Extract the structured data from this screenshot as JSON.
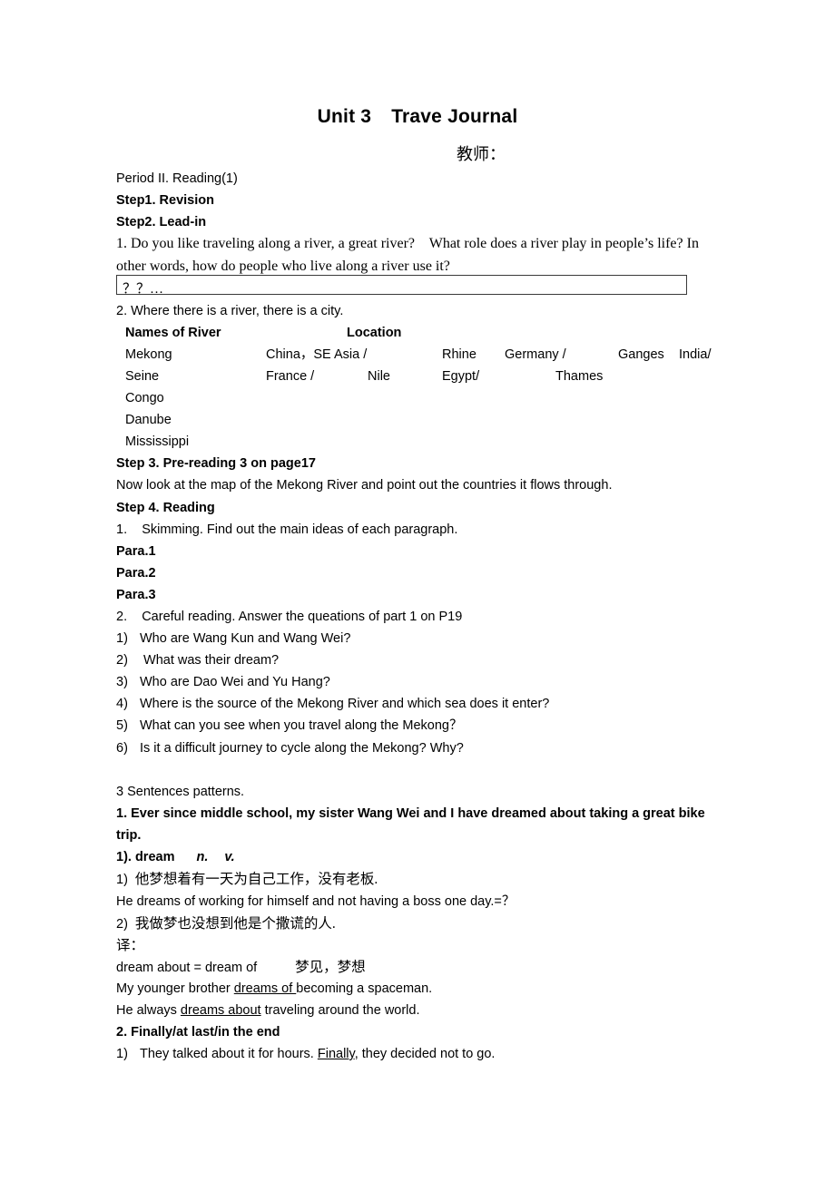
{
  "document": {
    "title_main": "Unit 3",
    "title_sub": "Trave Journal",
    "teacher_label": "教师：",
    "period": "Period II. Reading(1)",
    "step1": "Step1. Revision",
    "step2": "Step2. Lead-in",
    "lead_in_line1": "1. Do you like traveling along a river, a great river?    What role does a river play in people’s life? In",
    "lead_in_line2": "other words, how do people who live along a river use it?",
    "answer_box_text": "？？…",
    "where_line": "2. Where there is a river, there is a city.",
    "step3": "Step 3. Pre-reading 3 on page17",
    "step3_text": "Now look at the map of the Mekong River and point out the countries it flows through.",
    "step4": "Step 4. Reading",
    "skimming": "1.    Skimming. Find out the main ideas of each paragraph.",
    "para1": "Para.1",
    "para2": "Para.2",
    "para3": "Para.3",
    "careful_reading": "2.    Careful reading. Answer the queations of part 1 on P19",
    "questions": [
      {
        "num": "1)",
        "text": "Who are Wang Kun and Wang Wei?"
      },
      {
        "num": "2)",
        "text": " What was their dream?"
      },
      {
        "num": "3)",
        "text": "Who are Dao Wei and Yu Hang?"
      },
      {
        "num": "4)",
        "text": "Where is the source of the Mekong River and which sea does it enter?"
      },
      {
        "num": "5)",
        "text": "What can you see when you travel along the Mekong？"
      },
      {
        "num": "6)",
        "text": "Is it a difficult journey to cycle along the Mekong? Why?"
      }
    ],
    "sentences_heading": "3 Sentences patterns.",
    "pattern1_line1": "1. Ever since middle school, my sister Wang Wei and I have dreamed about taking a great bike",
    "pattern1_line2": "trip.",
    "dream_entry": "1). dream",
    "dream_pos_n": "n.",
    "dream_pos_v": "v.",
    "cn_example1_num": "1)",
    "cn_example1": "他梦想着有一天为自己工作，没有老板.",
    "en_example1": "He dreams of working for himself and not having a boss one day.=？",
    "cn_example2_num": "2)",
    "cn_example2": "我做梦也没想到他是个撒谎的人.",
    "translate_label": "译：",
    "dream_about_eq": "dream about = dream of",
    "dream_about_cn": "梦见，梦想",
    "spaceman_pre": "My younger brother ",
    "spaceman_underline": "dreams of ",
    "spaceman_post": "becoming a spaceman.",
    "world_pre": "He always ",
    "world_underline": "dreams about",
    "world_post": " traveling around the world.",
    "finally_heading": "2. Finally/at last/in the end",
    "finally_num": "1)",
    "finally_pre": "They talked about it for hours. ",
    "finally_underline": "Finally",
    "finally_post": ", they decided not to go."
  },
  "river_table": {
    "headers": {
      "names": "Names of River",
      "location": "Location"
    },
    "rows": [
      {
        "river": "Mekong",
        "location": "China，SE Asia /"
      },
      {
        "river": "Seine",
        "location": "France /"
      },
      {
        "river": "Congo",
        "location": ""
      },
      {
        "river": "Danube",
        "location": ""
      },
      {
        "river": "Mississippi",
        "location": ""
      }
    ],
    "extra": {
      "nile": "Nile",
      "rhine": "Rhine",
      "egypt": "Egypt/",
      "germany": "Germany /",
      "thames": "Thames",
      "ganges": "Ganges",
      "india": "India/"
    }
  }
}
